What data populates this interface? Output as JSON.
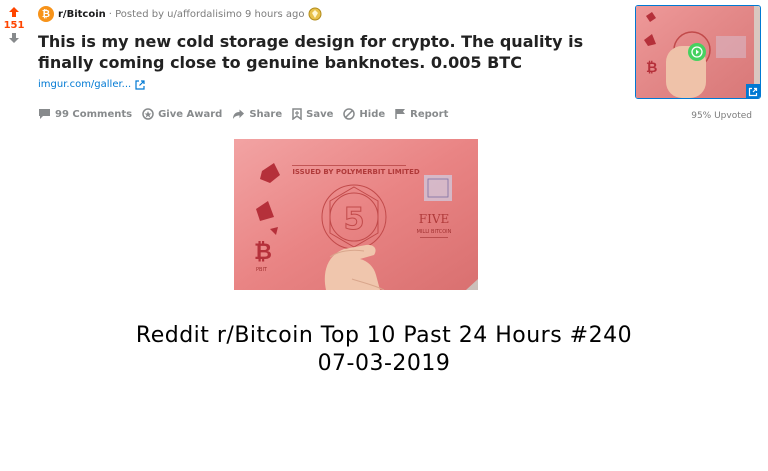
{
  "vote": {
    "score": "151"
  },
  "post": {
    "subreddit": "r/Bitcoin",
    "posted_by": "· Posted by u/affordalisimo 9 hours ago",
    "title": "This is my new cold storage design for crypto. The quality is finally coming close to genuine banknotes. 0.005 BTC",
    "link_text": "imgur.com/galler...",
    "upvoted": "95% Upvoted"
  },
  "actions": {
    "comments": "99 Comments",
    "give_award": "Give Award",
    "share": "Share",
    "save": "Save",
    "hide": "Hide",
    "report": "Report"
  },
  "banknote": {
    "issuer": "ISSUED BY POLYMERBIT LIMITED",
    "denomination": "FIVE",
    "sub_label": "MILLI BITCOIN",
    "numeral": "5"
  },
  "caption": {
    "line1": "Reddit r/Bitcoin Top 10 Past 24 Hours #240",
    "line2": "07-03-2019"
  },
  "colors": {
    "upvote": "#ff4500",
    "link": "#0079d3",
    "bitcoin": "#f7931a",
    "note": "#e06868"
  }
}
